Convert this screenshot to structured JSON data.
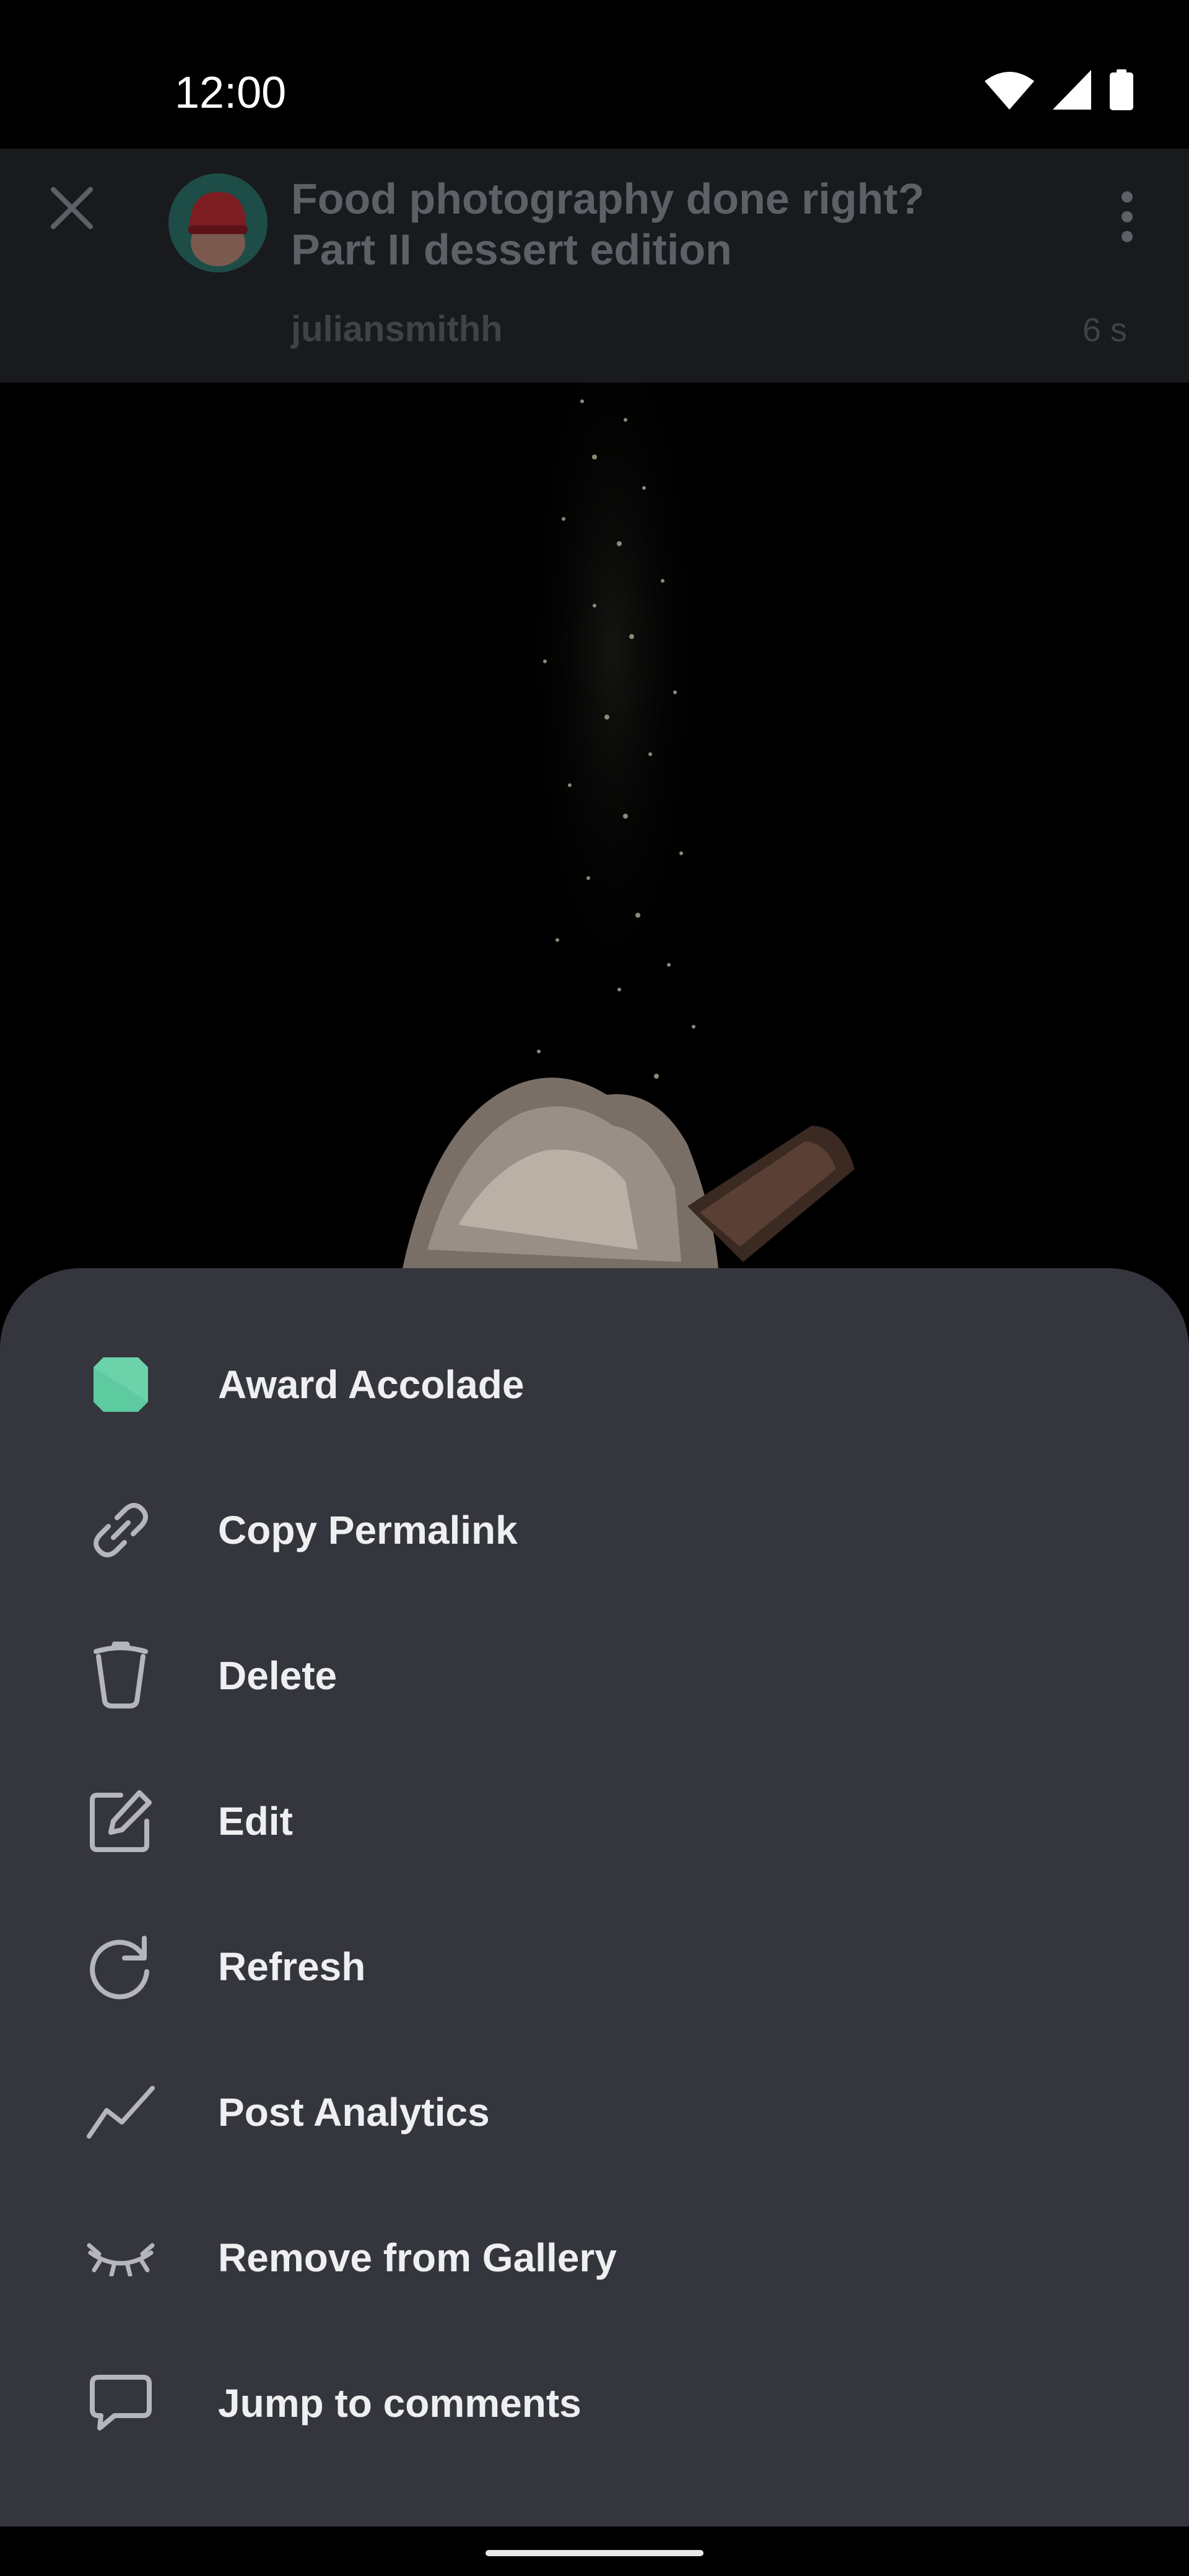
{
  "status_bar": {
    "time": "12:00",
    "icons": [
      "wifi-icon",
      "signal-icon",
      "battery-icon"
    ]
  },
  "post": {
    "title_line1": "Food photography done right?",
    "title_line2": "Part II dessert edition",
    "username": "juliansmithh",
    "time_ago": "6 s"
  },
  "menu": {
    "items": [
      {
        "label": "Award Accolade",
        "icon": "accolade-gem-icon"
      },
      {
        "label": "Copy Permalink",
        "icon": "link-icon"
      },
      {
        "label": "Delete",
        "icon": "trash-icon"
      },
      {
        "label": "Edit",
        "icon": "edit-icon"
      },
      {
        "label": "Refresh",
        "icon": "refresh-icon"
      },
      {
        "label": "Post Analytics",
        "icon": "analytics-icon"
      },
      {
        "label": "Remove from Gallery",
        "icon": "eye-closed-icon"
      },
      {
        "label": "Jump to comments",
        "icon": "comment-icon"
      }
    ]
  },
  "colors": {
    "sheet_bg": "#35363d",
    "accolade_green": "#5dcaa0"
  }
}
